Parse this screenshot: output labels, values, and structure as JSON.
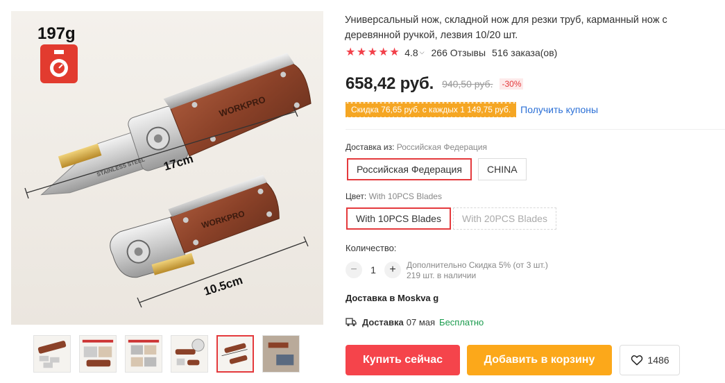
{
  "gallery": {
    "weight_label": "197g",
    "brand": "WORKPRO",
    "steel_label": "STAINLESS STEEL",
    "length_open": "17cm",
    "length_closed": "10.5cm",
    "thumbnails": [
      {
        "name": "thumb-1",
        "active": false
      },
      {
        "name": "thumb-2",
        "active": false
      },
      {
        "name": "thumb-3",
        "active": false
      },
      {
        "name": "thumb-4",
        "active": false
      },
      {
        "name": "thumb-5",
        "active": true
      },
      {
        "name": "thumb-6",
        "active": false
      }
    ]
  },
  "product": {
    "title": "Универсальный нож, складной нож для резки труб, карманный нож с деревянной ручкой, лезвия 10/20 шт.",
    "rating": "4.8",
    "rating_stars": 5,
    "reviews": "266 Отзывы",
    "orders": "516 заказа(ов)",
    "price": "658,42 руб.",
    "old_price": "940,50 руб.",
    "discount": "-30%",
    "coupon_text": "Скидка 76,65 руб. с каждых 1 149,75 руб.",
    "coupon_link": "Получить купоны"
  },
  "shipping_from": {
    "label": "Доставка из:",
    "value": "Российская Федерация",
    "options": [
      "Российская Федерация",
      "CHINA"
    ]
  },
  "color": {
    "label": "Цвет:",
    "value": "With 10PCS Blades",
    "options": [
      "With 10PCS Blades",
      "With 20PCS Blades"
    ]
  },
  "quantity": {
    "label": "Количество:",
    "minus": "−",
    "value": "1",
    "plus": "+",
    "extra_discount": "Дополнительно Скидка 5% (от 3 шт.)",
    "stock": "219 шт. в наличии"
  },
  "delivery": {
    "to": "Доставка в Moskva g",
    "label": "Доставка",
    "date": "07 мая",
    "price": "Бесплатно"
  },
  "actions": {
    "buy_now": "Купить сейчас",
    "add_to_cart": "Добавить в корзину",
    "wishlist_count": "1486"
  },
  "colors": {
    "accent_red": "#e4393c",
    "buy_button": "#f5444b",
    "cart_button": "#fca81a",
    "coupon_bg": "#f5a623",
    "link_blue": "#2a6fd6",
    "free_green": "#1a9b4d"
  },
  "icons": [
    "weight-scale-icon",
    "star-icon",
    "chevron-down-icon",
    "minus-icon",
    "plus-icon",
    "truck-icon",
    "heart-icon"
  ]
}
